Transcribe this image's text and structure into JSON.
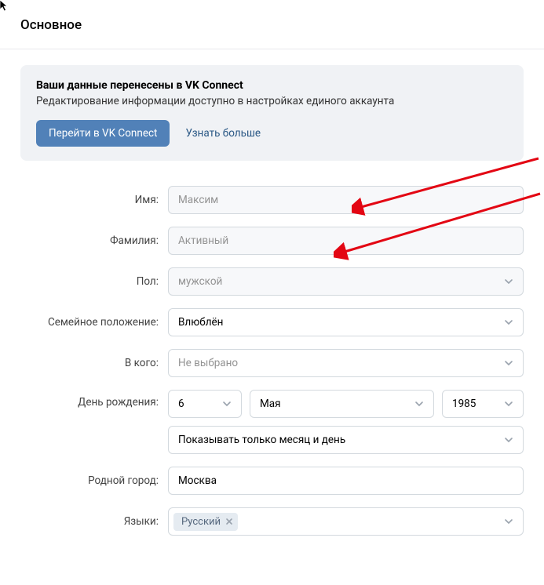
{
  "header": {
    "title": "Основное"
  },
  "notice": {
    "title": "Ваши данные перенесены в VK Connect",
    "text": "Редактирование информации доступно в настройках единого аккаунта",
    "primary_button_label": "Перейти в VK Connect",
    "link_label": "Узнать больше"
  },
  "form": {
    "first_name": {
      "label": "Имя:",
      "value": "Максим"
    },
    "last_name": {
      "label": "Фамилия:",
      "value": "Активный"
    },
    "gender": {
      "label": "Пол:",
      "value": "мужской"
    },
    "relationship": {
      "label": "Семейное положение:",
      "value": "Влюблён"
    },
    "interest_in": {
      "label": "В кого:",
      "value": "Не выбрано",
      "is_placeholder": true
    },
    "birthday": {
      "label": "День рождения:",
      "day": "6",
      "month": "Мая",
      "year": "1985",
      "visibility": "Показывать только месяц и день"
    },
    "hometown": {
      "label": "Родной город:",
      "value": "Москва"
    },
    "languages": {
      "label": "Языки:",
      "tags": [
        "Русский"
      ]
    }
  }
}
